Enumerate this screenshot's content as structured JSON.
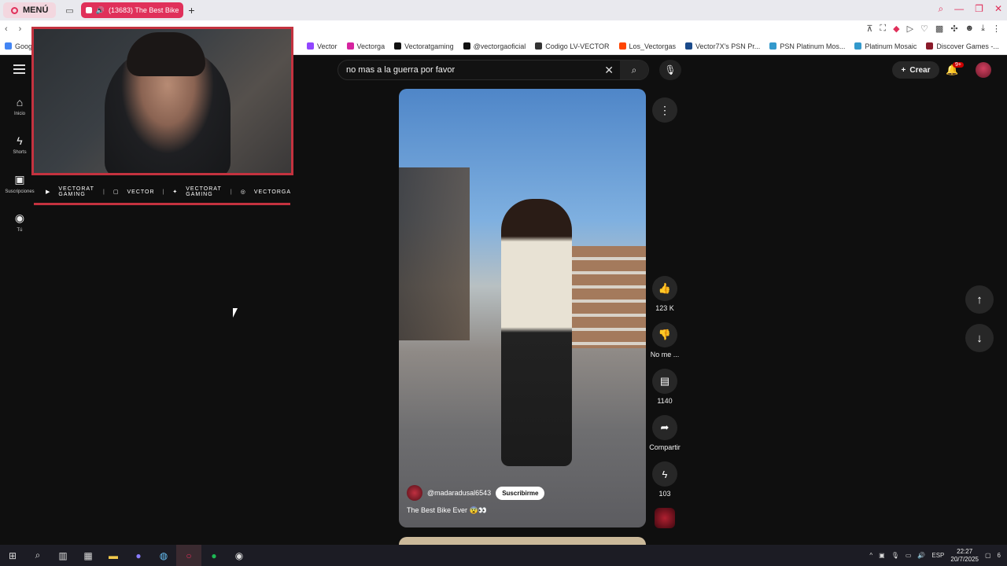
{
  "browser": {
    "menu_label": "MENÚ",
    "tab_title": "(13683) The Best Bike",
    "tab_add": "+",
    "window_controls": [
      "search-icon",
      "minimize-icon",
      "restore-icon",
      "close-icon"
    ],
    "bookmarks": [
      {
        "label": "Google",
        "color": "#4285f4"
      },
      {
        "label": "Vector",
        "color": "#9146ff"
      },
      {
        "label": "Vectorga",
        "color": "#d6249f"
      },
      {
        "label": "Vectoratgaming",
        "color": "#111111"
      },
      {
        "label": "@vectorgaoficial",
        "color": "#111111"
      },
      {
        "label": "Codigo LV-VECTOR",
        "color": "#333333"
      },
      {
        "label": "Los_Vectorgas",
        "color": "#ff4500"
      },
      {
        "label": "Vector7X's PSN Pr...",
        "color": "#1a4a8a"
      },
      {
        "label": "PSN Platinum Mos...",
        "color": "#3399cc"
      },
      {
        "label": "Platinum Mosaic",
        "color": "#3399cc"
      },
      {
        "label": "Discover Games -...",
        "color": "#8a1a2a"
      }
    ]
  },
  "youtube": {
    "search_query": "no mas a la guerra por favor",
    "create_label": "Crear",
    "notifications_badge": "9+",
    "sidebar": [
      {
        "label": "Inicio",
        "icon": "home-icon",
        "glyph": "⌂"
      },
      {
        "label": "Shorts",
        "icon": "shorts-icon",
        "glyph": "ϟ"
      },
      {
        "label": "Suscripciones",
        "icon": "subscriptions-icon",
        "glyph": "▣"
      },
      {
        "label": "Tú",
        "icon": "profile-icon",
        "glyph": "◉"
      }
    ],
    "short": {
      "channel": "@madaradusal6543",
      "subscribe_label": "Suscribirme",
      "caption": "The Best Bike Ever 😨👀"
    },
    "actions": {
      "likes": "123 K",
      "dislike_label": "No me ...",
      "comments": "1140",
      "share_label": "Compartir",
      "remix": "103"
    }
  },
  "overlay": {
    "socials": [
      {
        "icon": "youtube-icon",
        "text": "VECTORAT GAMING"
      },
      {
        "icon": "twitch-icon",
        "text": "VECTOR"
      },
      {
        "icon": "twitter-icon",
        "text": "VECTORAT GAMING"
      },
      {
        "icon": "instagram-icon",
        "text": "VECTORGA"
      }
    ],
    "accent": "#c4323f"
  },
  "taskbar": {
    "language": "ESP",
    "time": "22:27",
    "date": "20/7/2025",
    "notification_count": "6"
  }
}
